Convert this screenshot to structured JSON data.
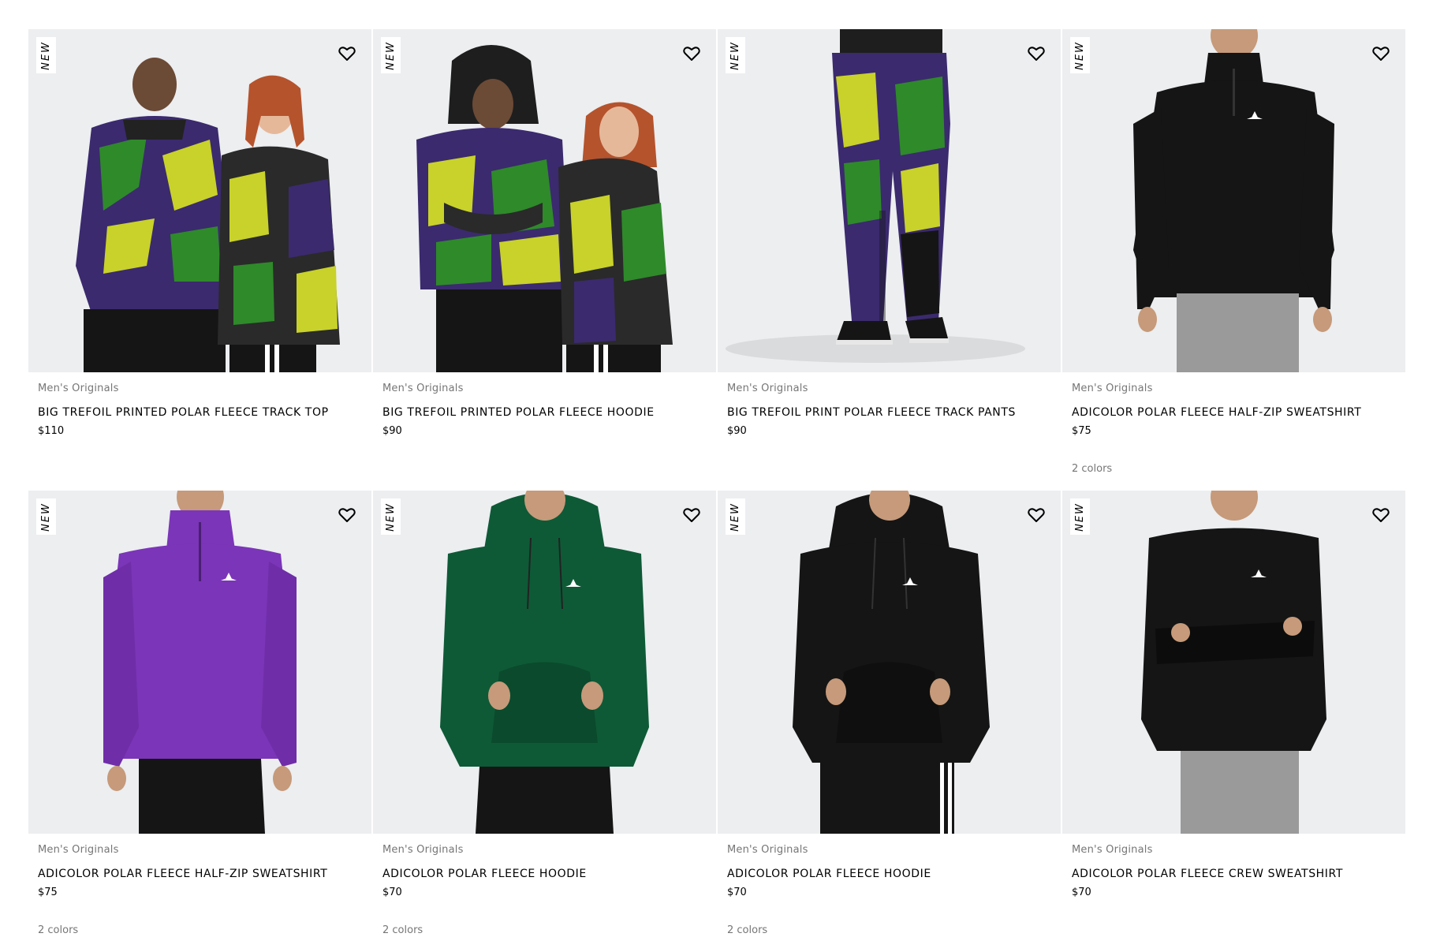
{
  "products": [
    {
      "badge": "NEW",
      "category": "Men's Originals",
      "name": "BIG TREFOIL PRINTED POLAR FLEECE TRACK TOP",
      "price": "$110",
      "colors": ""
    },
    {
      "badge": "NEW",
      "category": "Men's Originals",
      "name": "BIG TREFOIL PRINTED POLAR FLEECE HOODIE",
      "price": "$90",
      "colors": ""
    },
    {
      "badge": "NEW",
      "category": "Men's Originals",
      "name": "BIG TREFOIL PRINT POLAR FLEECE TRACK PANTS",
      "price": "$90",
      "colors": ""
    },
    {
      "badge": "NEW",
      "category": "Men's Originals",
      "name": "ADICOLOR POLAR FLEECE HALF-ZIP SWEATSHIRT",
      "price": "$75",
      "colors": "2 colors"
    },
    {
      "badge": "NEW",
      "category": "Men's Originals",
      "name": "ADICOLOR POLAR FLEECE HALF-ZIP SWEATSHIRT",
      "price": "$75",
      "colors": "2 colors"
    },
    {
      "badge": "NEW",
      "category": "Men's Originals",
      "name": "ADICOLOR POLAR FLEECE HOODIE",
      "price": "$70",
      "colors": "2 colors"
    },
    {
      "badge": "NEW",
      "category": "Men's Originals",
      "name": "ADICOLOR POLAR FLEECE HOODIE",
      "price": "$70",
      "colors": "2 colors"
    },
    {
      "badge": "NEW",
      "category": "Men's Originals",
      "name": "ADICOLOR POLAR FLEECE CREW SWEATSHIRT",
      "price": "$70",
      "colors": ""
    }
  ],
  "icons": {
    "wishlist": "heart-outline-icon",
    "logo": "trefoil-logo-icon"
  },
  "colors": {
    "image_background": "#eceef0",
    "muted_text": "#767677",
    "camo_purple": "#3b2a6e",
    "camo_green": "#2f8a2a",
    "camo_yellow": "#c8d22a",
    "purple_top": "#7b35b8",
    "green_hoodie": "#0e5a37",
    "black": "#111111",
    "grey_pants": "#9a9a9a"
  }
}
